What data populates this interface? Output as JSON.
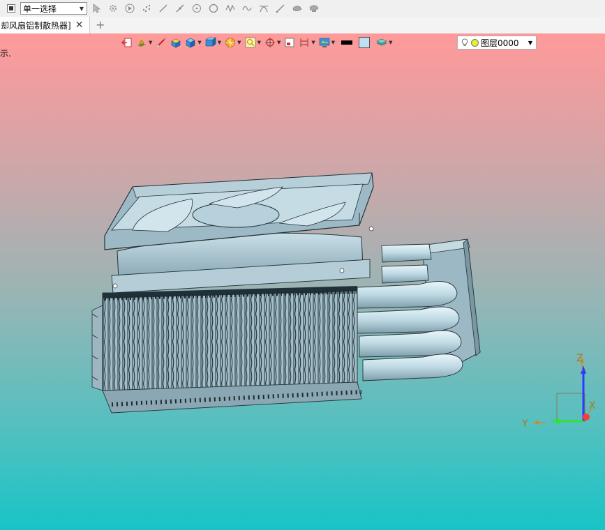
{
  "selection_toolbar": {
    "filter_value": "单一选择",
    "icons": [
      "select-arrow-icon",
      "select-gear-icon",
      "play-icon",
      "points-icon",
      "line-icon",
      "edge-icon",
      "circle-point-icon",
      "circle-icon",
      "curve-icon",
      "spline-icon",
      "arc-icon",
      "pick-icon",
      "part-icon",
      "assembly-icon"
    ]
  },
  "document_tab": {
    "title": "却风扇铝制散热器]",
    "close_glyph": "✕",
    "add_glyph": "+"
  },
  "viewport": {
    "hint_text": "示.",
    "background_top": "#ff9a9a",
    "background_bottom": "#17c4c6",
    "layer": {
      "name": "图层0000"
    },
    "triad": {
      "x_label": "X",
      "y_label": "Y",
      "z_label": "Z"
    }
  },
  "view_toolbar": {
    "icons": [
      "exit-icon",
      "render-mode-icon",
      "brush-icon",
      "shaded-box-icon",
      "solid-box-icon",
      "view-cube-icon",
      "section-icon",
      "zoom-fit-icon",
      "orient-icon",
      "frame-icon",
      "dimension-icon",
      "display-icon",
      "color-black-icon",
      "color-lightblue-icon",
      "layers-icon"
    ]
  }
}
